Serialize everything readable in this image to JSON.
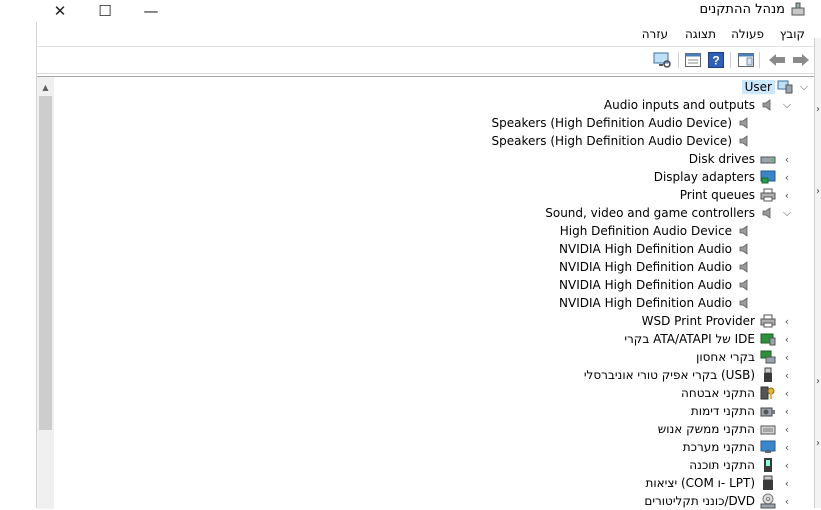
{
  "window": {
    "title": "מנהל ההתקנים",
    "close_glyph": "✕",
    "maximize_glyph": "☐",
    "minimize_glyph": "—"
  },
  "menu": [
    "קובץ",
    "פעולה",
    "תצוגה",
    "עזרה"
  ],
  "tree": {
    "root": "User",
    "categories": [
      {
        "label": "Audio inputs and outputs",
        "icon": "speaker-icon",
        "expanded": true,
        "children": [
          "Speakers (High Definition Audio Device)",
          "Speakers (High Definition Audio Device)"
        ]
      },
      {
        "label": "Disk drives",
        "icon": "disk-drive-icon",
        "expanded": false,
        "children": []
      },
      {
        "label": "Display adapters",
        "icon": "display-adapter-icon",
        "expanded": false,
        "children": []
      },
      {
        "label": "Print queues",
        "icon": "printer-icon",
        "expanded": false,
        "children": []
      },
      {
        "label": "Sound, video and game controllers",
        "icon": "speaker-icon",
        "expanded": true,
        "children": [
          "High Definition Audio Device",
          "NVIDIA High Definition Audio",
          "NVIDIA High Definition Audio",
          "NVIDIA High Definition Audio",
          "NVIDIA High Definition Audio"
        ]
      },
      {
        "label": "WSD Print Provider",
        "icon": "printer-icon",
        "expanded": false,
        "children": []
      },
      {
        "label": "בקרי ATA/ATAPI של IDE",
        "icon": "ide-controller-icon",
        "expanded": false,
        "children": []
      },
      {
        "label": "בקרי אחסון",
        "icon": "storage-controller-icon",
        "expanded": false,
        "children": []
      },
      {
        "label": "בקרי אפיק טורי אוניברסלי (USB)",
        "icon": "usb-icon",
        "expanded": false,
        "children": []
      },
      {
        "label": "התקני אבטחה",
        "icon": "security-key-icon",
        "expanded": false,
        "children": []
      },
      {
        "label": "התקני דימות",
        "icon": "camera-icon",
        "expanded": false,
        "children": []
      },
      {
        "label": "התקני ממשק אנוש",
        "icon": "hid-icon",
        "expanded": false,
        "children": []
      },
      {
        "label": "התקני מערכת",
        "icon": "system-device-icon",
        "expanded": false,
        "children": []
      },
      {
        "label": "התקני תוכנה",
        "icon": "software-device-icon",
        "expanded": false,
        "children": []
      },
      {
        "label": "יציאות (COM ו- LPT)",
        "icon": "port-icon",
        "expanded": false,
        "children": []
      },
      {
        "label": "כונני תקליטורים/DVD",
        "icon": "dvd-drive-icon",
        "expanded": false,
        "children": []
      }
    ]
  }
}
